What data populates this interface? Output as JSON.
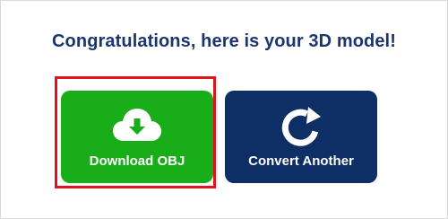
{
  "heading": "Congratulations, here is your 3D model!",
  "buttons": {
    "download": {
      "label": "Download OBJ",
      "icon": "cloud-download-icon"
    },
    "convert": {
      "label": "Convert Another",
      "icon": "refresh-icon"
    }
  },
  "colors": {
    "heading": "#1a3570",
    "download_bg": "#1aad1a",
    "convert_bg": "#0e2e66",
    "highlight": "#e0151b"
  }
}
